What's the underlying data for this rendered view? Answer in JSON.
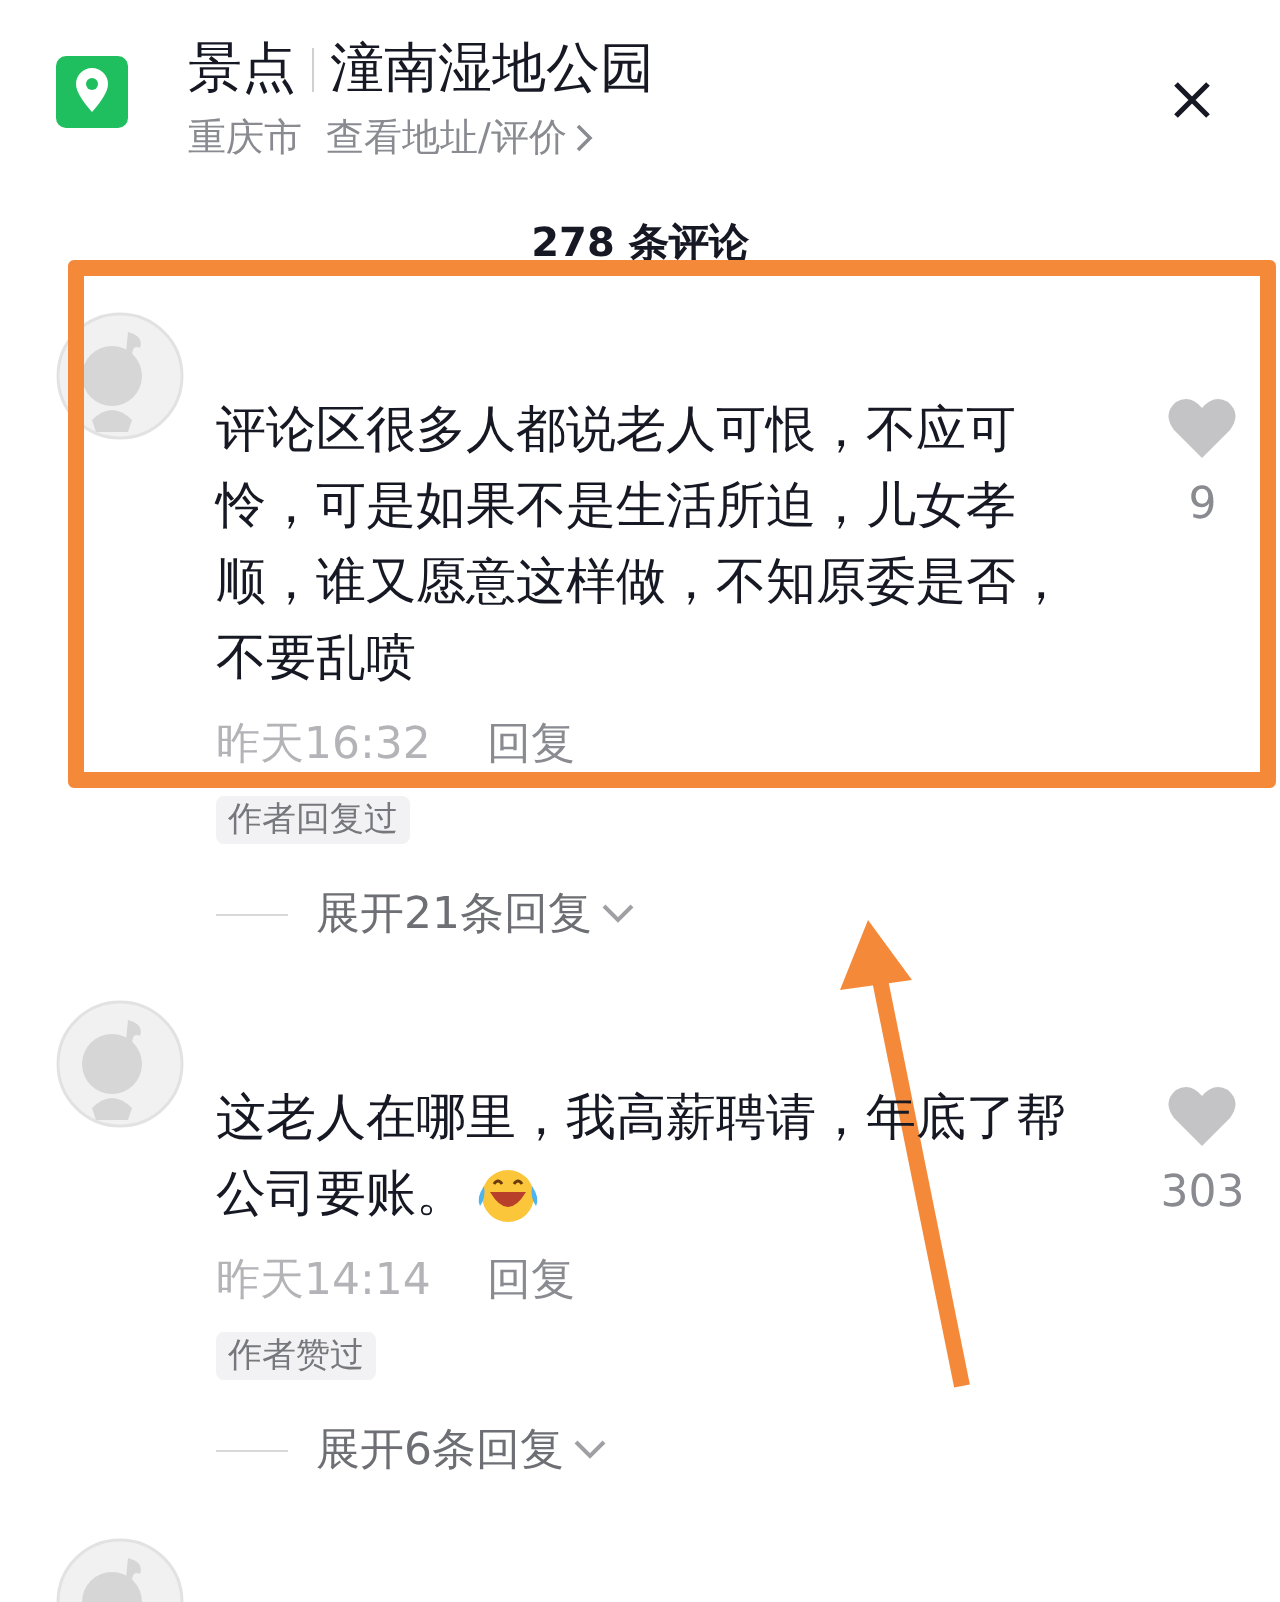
{
  "place": {
    "category": "景点",
    "name": "潼南湿地公园",
    "city": "重庆市",
    "link": "查看地址/评价"
  },
  "comment_count": "278 条评论",
  "comments": [
    {
      "text": "评论区很多人都说老人可恨，不应可怜，可是如果不是生活所迫，儿女孝顺，谁又愿意这样做，不知原委是否，不要乱喷",
      "emoji": false,
      "time": "昨天16:32",
      "reply": "回复",
      "badge": "作者回复过",
      "expand": "展开21条回复",
      "likes": "9",
      "liked": false
    },
    {
      "text": "这老人在哪里，我高薪聘请，年底了帮公司要账。",
      "emoji": true,
      "time": "昨天14:14",
      "reply": "回复",
      "badge": "作者赞过",
      "expand": "展开6条回复",
      "likes": "303",
      "liked": false
    }
  ]
}
